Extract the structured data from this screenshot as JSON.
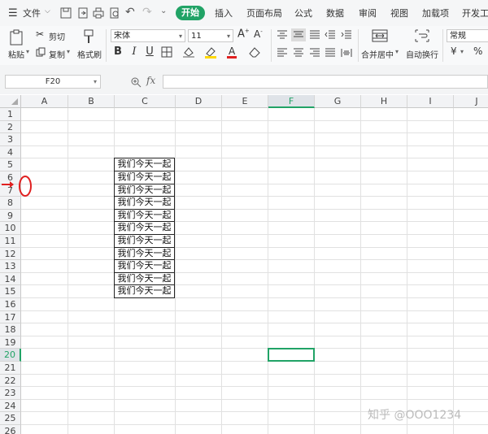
{
  "menubar": {
    "file_label": "文件",
    "tabs": [
      "开始",
      "插入",
      "页面布局",
      "公式",
      "数据",
      "审阅",
      "视图",
      "加载项",
      "开发工具"
    ]
  },
  "ribbon": {
    "paste": "粘贴",
    "cut": "剪切",
    "copy": "复制",
    "format_painter": "格式刷",
    "font_name": "宋体",
    "font_size": "11",
    "bold": "B",
    "italic": "I",
    "underline": "U",
    "merge_center": "合并居中",
    "wrap_text": "自动换行",
    "number_format": "常规",
    "currency": "¥"
  },
  "formula_bar": {
    "name_box": "F20",
    "fx": "fx",
    "content": ""
  },
  "sheet": {
    "columns": [
      "A",
      "B",
      "C",
      "D",
      "E",
      "F",
      "G",
      "H",
      "I",
      "J"
    ],
    "rows": [
      "1",
      "2",
      "3",
      "4",
      "5",
      "6",
      "7",
      "8",
      "9",
      "10",
      "11",
      "12",
      "13",
      "14",
      "15",
      "16",
      "17",
      "18",
      "19",
      "20",
      "21",
      "22",
      "23",
      "24",
      "25",
      "26",
      "27"
    ],
    "cells_c": [
      "我们今天一起",
      "我们今天一起",
      "我们今天一起",
      "我们今天一起",
      "我们今天一起",
      "我们今天一起",
      "我们今天一起",
      "我们今天一起",
      "我们今天一起",
      "我们今天一起",
      "我们今天一起"
    ],
    "selected_cell": "F20"
  },
  "watermark": "知乎 @OOO1234",
  "colors": {
    "accent": "#21a366",
    "annotation": "#e02020"
  }
}
